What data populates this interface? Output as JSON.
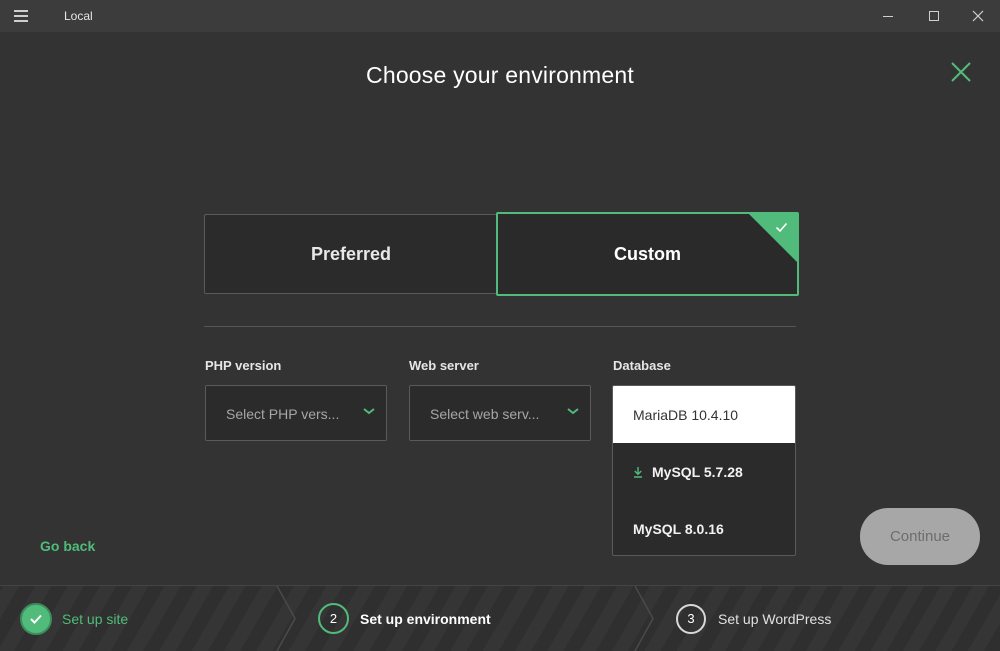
{
  "window": {
    "title": "Local"
  },
  "heading": "Choose your environment",
  "environment_options": [
    {
      "label": "Preferred",
      "selected": false
    },
    {
      "label": "Custom",
      "selected": true
    }
  ],
  "php": {
    "label": "PHP version",
    "placeholder": "Select PHP vers..."
  },
  "webserver": {
    "label": "Web server",
    "placeholder": "Select web serv..."
  },
  "database": {
    "label": "Database",
    "options": [
      {
        "label": "MariaDB 10.4.10",
        "selected": true,
        "download": false
      },
      {
        "label": "MySQL 5.7.28",
        "selected": false,
        "download": true
      },
      {
        "label": "MySQL 8.0.16",
        "selected": false,
        "download": false
      }
    ]
  },
  "actions": {
    "back": "Go back",
    "continue": "Continue"
  },
  "steps": [
    {
      "number": "",
      "label": "Set up site",
      "status": "done"
    },
    {
      "number": "2",
      "label": "Set up environment",
      "status": "current"
    },
    {
      "number": "3",
      "label": "Set up WordPress",
      "status": "todo"
    }
  ],
  "colors": {
    "accent": "#51bb7b",
    "background": "#333333",
    "titlebar": "#3c3c3c"
  }
}
